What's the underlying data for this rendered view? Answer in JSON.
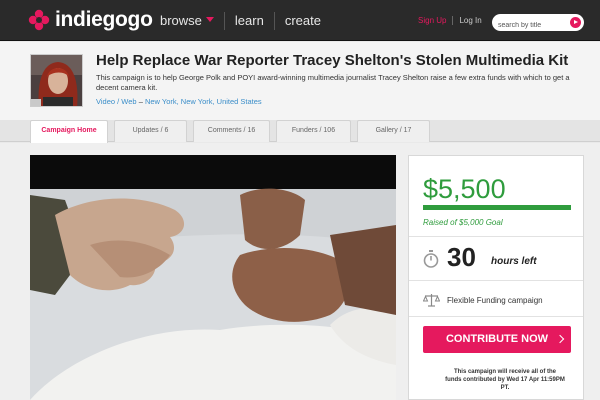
{
  "brand": {
    "name": "indiegogo"
  },
  "nav": {
    "items": [
      "browse",
      "learn",
      "create"
    ]
  },
  "auth": {
    "signup": "Sign Up",
    "login": "Log In"
  },
  "search": {
    "placeholder": "search by title"
  },
  "campaign": {
    "title": "Help Replace War Reporter Tracey Shelton's Stolen Multimedia Kit",
    "description": "This campaign is to help George Polk and POYI award-winning multimedia journalist Tracey Shelton raise a few extra funds with which to get a decent camera kit.",
    "category": "Video / Web",
    "location_sep": "–",
    "location": "New York, New York, United States"
  },
  "tabs": [
    {
      "label": "Campaign Home"
    },
    {
      "label": "Updates / 6"
    },
    {
      "label": "Comments / 16"
    },
    {
      "label": "Funders / 106"
    },
    {
      "label": "Gallery / 17"
    }
  ],
  "funding": {
    "amount": "$5,500",
    "goal_text": "Raised of $5,000 Goal",
    "progress": 1.0,
    "time_value": "30",
    "time_label": "hours left",
    "type": "Flexible Funding campaign",
    "button": "CONTRIBUTE NOW",
    "note": "This campaign will receive all of the funds contributed by Wed 17 Apr 11:59PM PT."
  },
  "colors": {
    "brand_pink": "#e5195e",
    "funding_green": "#2f9c3d",
    "link_blue": "#3b8ec9"
  }
}
